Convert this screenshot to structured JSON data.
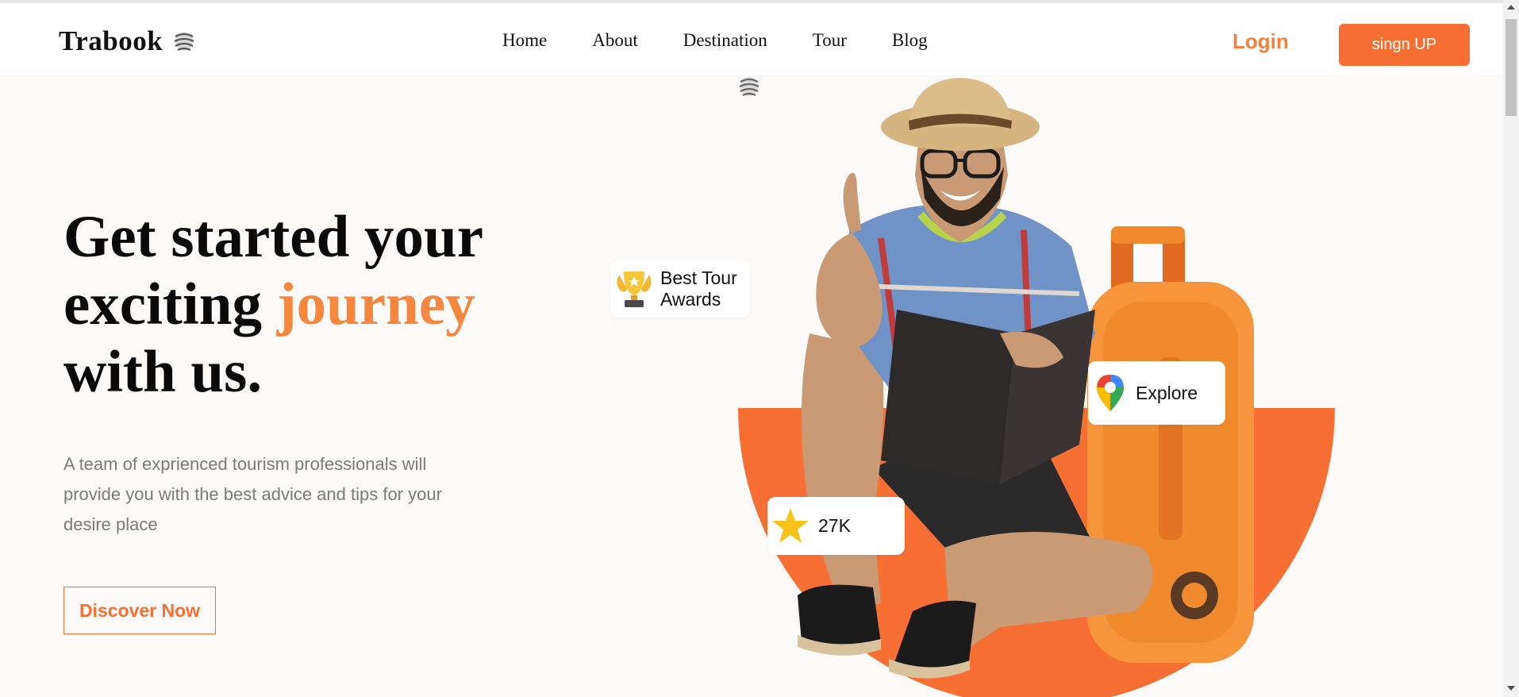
{
  "brand": {
    "name": "Trabook",
    "icon": "globe-logo-icon"
  },
  "nav": {
    "links": [
      "Home",
      "About",
      "Destination",
      "Tour",
      "Blog"
    ],
    "login_label": "Login",
    "signup_label": "singn UP"
  },
  "hero": {
    "title_part1": "Get started your exciting",
    "title_accent": "journey",
    "title_part2": "with us.",
    "description": "A team of exprienced tourism professionals will provide you with the best advice and tips for your desire place",
    "cta_label": "Discover Now"
  },
  "badges": {
    "award": {
      "line1": "Best Tour",
      "line2": "Awards",
      "icon": "trophy-icon"
    },
    "explore": {
      "label": "Explore",
      "icon": "map-pin-icon"
    },
    "rating": {
      "label": "27K",
      "icon": "star-icon"
    }
  },
  "colors": {
    "accent": "#f76f33",
    "accent_text": "#f5873e",
    "background": "#fcfaf9"
  }
}
